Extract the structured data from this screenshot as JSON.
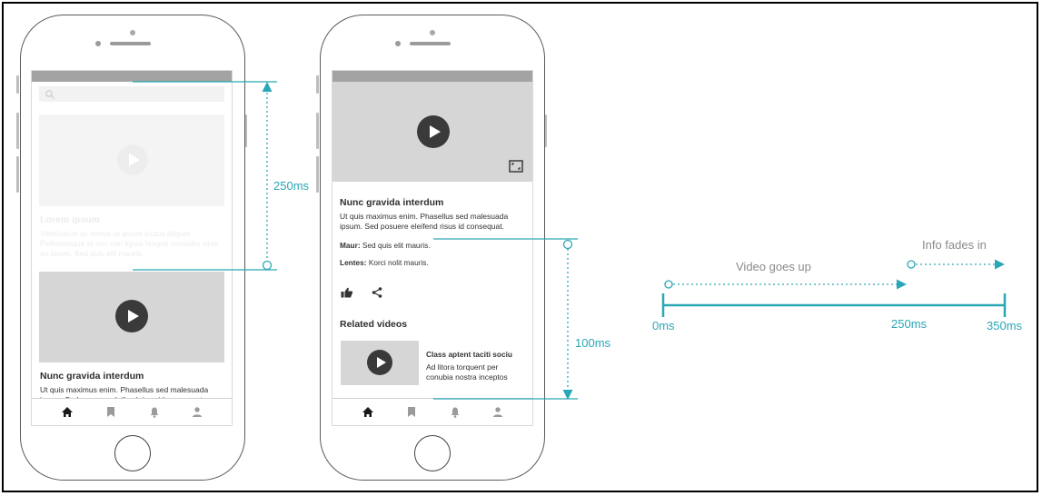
{
  "phone1": {
    "faded_title": "Lorem ipsum",
    "faded_body": "Vestibulum ac metus ut ipsum luctus aliquet. Pellentesque et orci non ligula feugiat convallis vitae eu lorem. Sed quis elit mauris.",
    "video_title": "Nunc gravida interdum",
    "video_body": "Ut quis maximus enim. Phasellus sed malesuada ipsum. Sed posuere eleifend risus id consequat."
  },
  "phone2": {
    "video_title": "Nunc gravida interdum",
    "video_body": "Ut quis maximus enim. Phasellus sed malesuada ipsum. Sed posuere eleifend risus id consequat.",
    "meta1_key": "Maur:",
    "meta1_value": " Sed quis elit mauris.",
    "meta2_key": "Lentes:",
    "meta2_value": " Korci nolit mauris.",
    "related_heading": "Related videos",
    "related_title": "Class aptent taciti sociu",
    "related_body": "Ad litora torquent per conubia nostra inceptos"
  },
  "annotations": {
    "dur1": "250ms",
    "dur2": "100ms"
  },
  "timeline": {
    "label_up": "Video goes up",
    "label_fade": "Info fades in",
    "t0": "0ms",
    "t1": "250ms",
    "t2": "350ms"
  },
  "colors": {
    "accent": "#2aa7b6",
    "placeholder": "#d6d6d6",
    "play": "#3a3a3a"
  },
  "icons": [
    "search-icon",
    "play-icon",
    "fullscreen-icon",
    "like-icon",
    "share-icon",
    "home-icon",
    "bookmark-icon",
    "bell-icon",
    "user-icon"
  ]
}
